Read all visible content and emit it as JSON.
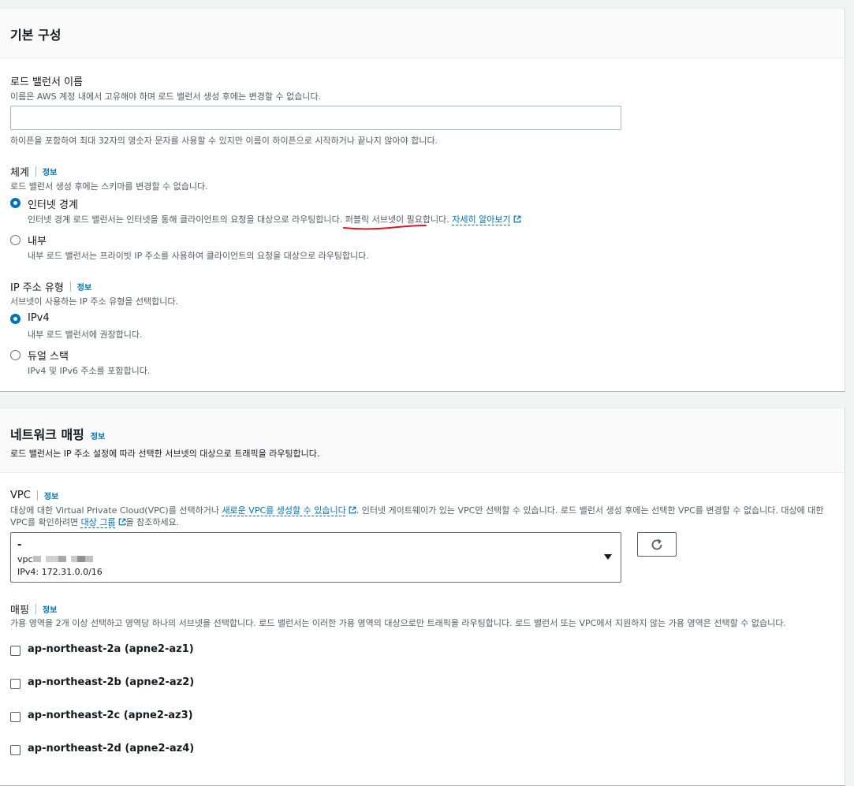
{
  "basic": {
    "title": "기본 구성",
    "lb_name": {
      "label": "로드 밸런서 이름",
      "desc": "이름은 AWS 계정 내에서 고유해야 하며 로드 밸런서 생성 후에는 변경할 수 없습니다.",
      "value": "",
      "hint": "하이픈을 포함하여 최대 32자의 영숫자 문자를 사용할 수 있지만 이름이 하이픈으로 시작하거나 끝나지 않아야 합니다."
    },
    "scheme": {
      "label": "체계",
      "info": "정보",
      "desc": "로드 밸런서 생성 후에는 스키마를 변경할 수 없습니다.",
      "options": [
        {
          "label": "인터넷 경계",
          "desc_pre": "인터넷 경계 로드 밸런서는 인터넷을 통해 클라이언트의 요청을 대상으로 라우팅합니다. ",
          "desc_mid": "퍼블릭 서브넷이 필요합니다.",
          "link": "자세히 알아보기",
          "selected": true
        },
        {
          "label": "내부",
          "desc": "내부 로드 밸런서는 프라이빗 IP 주소를 사용하여 클라이언트의 요청을 대상으로 라우팅합니다.",
          "selected": false
        }
      ]
    },
    "ip_type": {
      "label": "IP 주소 유형",
      "info": "정보",
      "desc": "서브넷이 사용하는 IP 주소 유형을 선택합니다.",
      "options": [
        {
          "label": "IPv4",
          "desc": "내부 로드 밸런서에 권장합니다.",
          "selected": true
        },
        {
          "label": "듀얼 스택",
          "desc": "IPv4 및 IPv6 주소를 포함합니다.",
          "selected": false
        }
      ]
    }
  },
  "network": {
    "title": "네트워크 매핑",
    "info": "정보",
    "desc": "로드 밸런서는 IP 주소 설정에 따라 선택한 서브넷의 대상으로 트래픽을 라우팅합니다.",
    "vpc": {
      "label": "VPC",
      "info": "정보",
      "desc_1": "대상에 대한 Virtual Private Cloud(VPC)를 선택하거나 ",
      "desc_link_1": "새로운 VPC를 생성할 수 있습니다",
      "desc_2": ". 인터넷 게이트웨이가 있는 VPC만 선택할 수 있습니다. 로드 밸런서 생성 후에는 선택한 VPC를 변경할 수 없습니다. 대상에 대한 VPC를 확인하려면 ",
      "desc_link_2": "대상 그룹",
      "desc_3": "을 참조하세요.",
      "selected_name": "-",
      "selected_id_prefix": "vpc",
      "selected_cidr": "IPv4: 172.31.0.0/16"
    },
    "mapping": {
      "label": "매핑",
      "info": "정보",
      "desc": "가용 영역을 2개 이상 선택하고 영역당 하나의 서브넷을 선택합니다. 로드 밸런서는 이러한 가용 영역의 대상으로만 트래픽을 라우팅합니다. 로드 밸런서 또는 VPC에서 지원하지 않는 가용 영역은 선택할 수 없습니다.",
      "zones": [
        "ap-northeast-2a (apne2-az1)",
        "ap-northeast-2b (apne2-az2)",
        "ap-northeast-2c (apne2-az3)",
        "ap-northeast-2d (apne2-az4)"
      ]
    }
  },
  "colors": {
    "accent": "#0073bb",
    "annotation": "#e0141e"
  },
  "icons": [
    "external-link-icon",
    "dropdown-caret-icon",
    "refresh-icon"
  ]
}
